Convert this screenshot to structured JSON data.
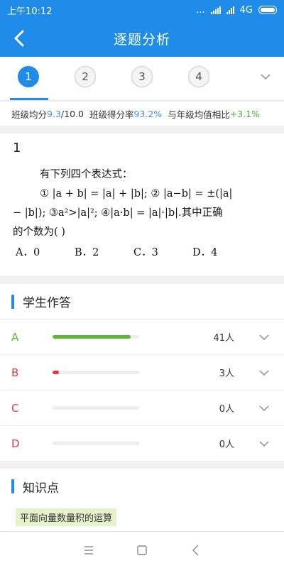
{
  "status_bar": {
    "time": "上午10:12",
    "dots": "...",
    "network": "4G"
  },
  "nav": {
    "title": "逐题分析"
  },
  "question_tabs": [
    "1",
    "2",
    "3",
    "4"
  ],
  "stats": {
    "class_avg_label": "班级均分",
    "class_avg_value": "9.3",
    "class_avg_total": "/10.0",
    "score_rate_label": "班级得分率",
    "score_rate_value": "93.2%",
    "compare_label": "与年级均值相比",
    "compare_value": "+3.1%"
  },
  "question": {
    "number": "1",
    "line1": "有下列四个表达式：",
    "line2": "① |a + b| = |a| + |b|; ② |a−b| = ±(|a|",
    "line3": "− |b|); ③a²>|a|²; ④|a·b| = |a|·|b|.其中正确",
    "line4": "的个数为(      )",
    "options": [
      "A．0",
      "B．2",
      "C．3",
      "D．4"
    ]
  },
  "answers": {
    "title": "学生作答",
    "rows": [
      {
        "option": "A",
        "count": "41人",
        "fraction": 0.9,
        "color": "#5bb92e",
        "label_color": "#5bb92e"
      },
      {
        "option": "B",
        "count": "3人",
        "fraction": 0.07,
        "color": "#e53935",
        "label_color": "#e53935"
      },
      {
        "option": "C",
        "count": "0人",
        "fraction": 0,
        "color": "#e53935",
        "label_color": "#e53935"
      },
      {
        "option": "D",
        "count": "0人",
        "fraction": 0,
        "color": "#e53935",
        "label_color": "#e53935"
      }
    ]
  },
  "knowledge": {
    "title": "知识点",
    "tags": [
      "平面向量数量积的运算"
    ]
  },
  "colors": {
    "primary": "#1e8ce8",
    "correct": "#5bb92e",
    "wrong": "#e53935"
  }
}
